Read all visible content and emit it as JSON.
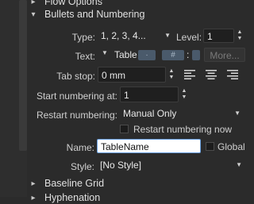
{
  "sections": {
    "flow_options": "Flow Options",
    "bullets_numbering": "Bullets and Numbering",
    "baseline_grid": "Baseline Grid",
    "hyphenation": "Hyphenation"
  },
  "type": {
    "label": "Type:",
    "value": "1, 2, 3, 4...",
    "icon": "chevron-down-icon"
  },
  "level": {
    "label": "Level:",
    "value": "1"
  },
  "text": {
    "label": "Text:",
    "dropdown_value": "Table",
    "chip_hash": "#",
    "more_label": "More..."
  },
  "tab_stop": {
    "label": "Tab stop:",
    "value": "0 mm"
  },
  "start_numbering": {
    "label": "Start numbering at:",
    "value": "1"
  },
  "restart_numbering": {
    "label": "Restart numbering:",
    "value": "Manual Only"
  },
  "restart_now": {
    "label": "Restart numbering now",
    "checked": false
  },
  "name": {
    "label": "Name:",
    "value": "TableName"
  },
  "global": {
    "label": "Global",
    "checked": false
  },
  "style": {
    "label": "Style:",
    "value": "[No Style]"
  },
  "colors": {
    "accent": "#3d7fd4",
    "background": "#2b2b2b",
    "field": "#1f1f1f"
  }
}
